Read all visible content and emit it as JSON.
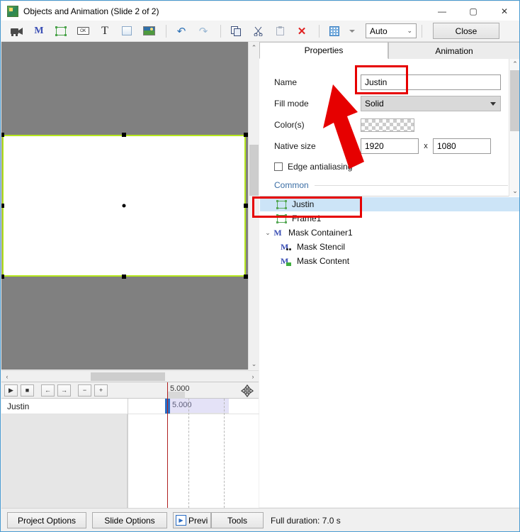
{
  "window": {
    "title": "Objects and Animation (Slide 2 of 2)",
    "app_icon": "app-image-icon",
    "minimize": "—",
    "maximize": "▢",
    "close": "✕"
  },
  "toolbar": {
    "items": [
      {
        "name": "video-camera-icon",
        "glyph": "🎥",
        "type": "cam"
      },
      {
        "name": "mask-icon",
        "glyph": "M",
        "type": "m"
      },
      {
        "name": "frame-icon",
        "glyph": "",
        "type": "frame"
      },
      {
        "name": "button-icon",
        "glyph": "OK",
        "type": "btnbox"
      },
      {
        "name": "text-icon",
        "glyph": "T",
        "type": "T"
      },
      {
        "name": "rectangle-icon",
        "glyph": "",
        "type": "rect"
      },
      {
        "name": "image-icon",
        "glyph": "",
        "type": "img"
      }
    ],
    "undo": "↶",
    "redo": "↷",
    "copy": "⧉",
    "cut": "✂",
    "paste": "📋",
    "delete": "✕",
    "grid_caret": "▾",
    "zoom_value": "Auto",
    "zoom_caret": "⌄",
    "close_label": "Close",
    "nav_prev": "◀",
    "nav_next": "▶"
  },
  "canvas": {
    "scroll_up": "⌃",
    "scroll_down": "⌄",
    "scroll_left": "‹",
    "scroll_right": "›"
  },
  "panel": {
    "tabs": [
      {
        "label": "Properties",
        "active": true
      },
      {
        "label": "Animation",
        "active": false
      }
    ],
    "scroll_up": "⌃",
    "scroll_down": "⌄",
    "fields": {
      "name_label": "Name",
      "name_value": "Justin",
      "fill_mode_label": "Fill mode",
      "fill_mode_value": "Solid",
      "colors_label": "Color(s)",
      "colors_value": "transparent-checker",
      "native_size_label": "Native size",
      "native_width": "1920",
      "native_sep": "x",
      "native_height": "1080",
      "edge_antialiasing_label": "Edge antialiasing",
      "edge_antialiasing_checked": false,
      "common_label": "Common"
    }
  },
  "tree": {
    "nodes": [
      {
        "label": "Justin",
        "icon": "frame-icon",
        "indent": 0,
        "selected": true,
        "twist": ""
      },
      {
        "label": "Frame1",
        "icon": "frame-icon",
        "indent": 0,
        "selected": false,
        "twist": ""
      },
      {
        "label": "Mask Container1",
        "icon": "mask-container-icon",
        "indent": 0,
        "selected": false,
        "twist": "⌄"
      },
      {
        "label": "Mask Stencil",
        "icon": "mask-stencil-icon",
        "indent": 1,
        "selected": false,
        "twist": ""
      },
      {
        "label": "Mask Content",
        "icon": "mask-content-icon",
        "indent": 1,
        "selected": false,
        "twist": ""
      }
    ]
  },
  "timeline": {
    "buttons": [
      {
        "name": "play-button",
        "glyph": "▶"
      },
      {
        "name": "stop-button",
        "glyph": "■"
      },
      {
        "name": "prev-keyframe-button",
        "glyph": "←"
      },
      {
        "name": "next-keyframe-button",
        "glyph": "→"
      },
      {
        "name": "zoom-out-button",
        "glyph": "−"
      },
      {
        "name": "zoom-in-button",
        "glyph": "+"
      }
    ],
    "ruler_time": "5.000",
    "move_icon": "✥",
    "track_name": "Justin",
    "keyframe_time": "5.000"
  },
  "bottombar": {
    "project_options": "Project Options",
    "slide_options": "Slide Options",
    "preview": "Previ",
    "preview_icon": "▶",
    "tools": "Tools",
    "full_duration": "Full duration: 7.0 s"
  },
  "annotations": {
    "highlight_color": "#e60000",
    "boxes": [
      "name-field-highlight",
      "tree-justin-highlight"
    ],
    "arrow": "arrow-from-tree-to-name-field"
  }
}
